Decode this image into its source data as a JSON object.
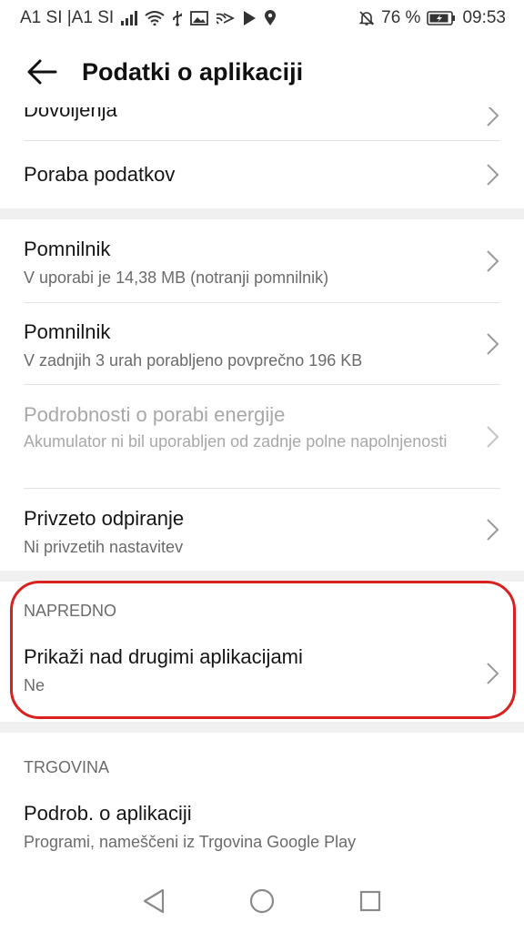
{
  "status_bar": {
    "carrier": "A1 SI |A1 SI",
    "battery_percent": "76 %",
    "time": "09:53",
    "icons": [
      "signal-icon",
      "wifi-icon",
      "usb-icon",
      "gallery-icon",
      "cast-icon",
      "play-store-icon",
      "location-icon",
      "mute-icon",
      "battery-icon"
    ]
  },
  "app_bar": {
    "title": "Podatki o aplikaciji"
  },
  "sections": {
    "top_partial": {
      "title": "Dovoljenja"
    },
    "data_usage": {
      "title": "Poraba podatkov"
    },
    "storage": {
      "title": "Pomnilnik",
      "sub": "V uporabi je 14,38 MB (notranji pomnilnik)"
    },
    "memory": {
      "title": "Pomnilnik",
      "sub": "V zadnjih 3 urah porabljeno povprečno 196 KB"
    },
    "energy": {
      "title": "Podrobnosti o porabi energije",
      "sub": "Akumulator ni bil uporabljen od zadnje polne napolnjenosti"
    },
    "open_default": {
      "title": "Privzeto odpiranje",
      "sub": "Ni privzetih nastavitev"
    },
    "advanced_header": "NAPREDNO",
    "overlay": {
      "title": "Prikaži nad drugimi aplikacijami",
      "sub": "Ne"
    },
    "store_header": "TRGOVINA",
    "app_details": {
      "title": "Podrob. o aplikaciji",
      "sub": "Programi, nameščeni iz Trgovina Google Play"
    }
  },
  "colors": {
    "highlight": "#d9211f",
    "section_gap": "#f0f0f0"
  }
}
